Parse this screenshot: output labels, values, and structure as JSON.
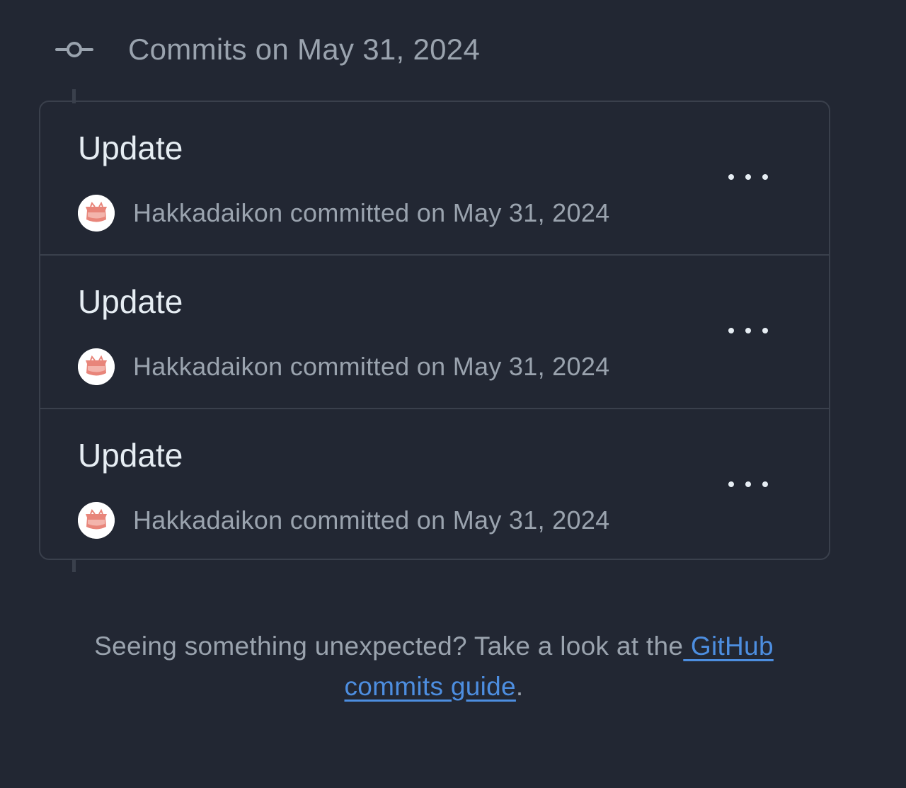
{
  "header": {
    "title": "Commits on May 31, 2024",
    "icon": "git-commit-icon"
  },
  "commits": [
    {
      "title": "Update",
      "byline": "Hakkadaikon committed on May 31, 2024",
      "avatar_icon": "user-avatar",
      "menu_icon": "kebab-horizontal-icon"
    },
    {
      "title": "Update",
      "byline": "Hakkadaikon committed on May 31, 2024",
      "avatar_icon": "user-avatar",
      "menu_icon": "kebab-horizontal-icon"
    },
    {
      "title": "Update",
      "byline": "Hakkadaikon committed on May 31, 2024",
      "avatar_icon": "user-avatar",
      "menu_icon": "kebab-horizontal-icon"
    }
  ],
  "footer": {
    "prefix": "Seeing something unexpected? Take a look at the",
    "link_part1": " GitHub",
    "link_part2": "commits guide",
    "suffix": "."
  },
  "colors": {
    "background": "#222733",
    "border": "#3a404c",
    "text_primary": "#e6edf3",
    "text_muted": "#9aa3ae",
    "link": "#4d8ee0",
    "avatar_accent": "#e8857a"
  }
}
